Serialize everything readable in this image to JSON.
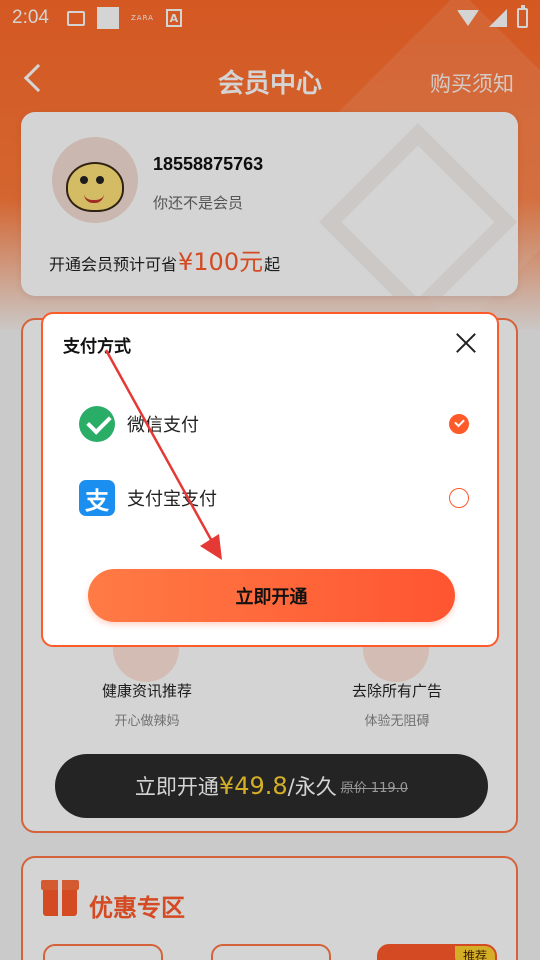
{
  "status_bar": {
    "time": "2:04",
    "notif_text_icon": "ZARA",
    "notif_letter_icon": "A"
  },
  "nav": {
    "title": "会员中心",
    "right_link": "购买须知"
  },
  "member_card": {
    "phone": "18558875763",
    "status": "你还不是会员",
    "save_prefix": "开通会员预计可省",
    "save_amount": "¥100元",
    "save_suffix": "起"
  },
  "benefits": [
    {
      "title": "健康资讯推荐",
      "subtitle": "开心做辣妈"
    },
    {
      "title": "去除所有广告",
      "subtitle": "体验无阻碍"
    }
  ],
  "open_bar": {
    "prefix": "立即开通",
    "price": "¥49.8",
    "period": "/永久",
    "original": "原价 119.0"
  },
  "promo": {
    "title": "优惠专区",
    "badge": "推荐"
  },
  "payment_dialog": {
    "title": "支付方式",
    "options": [
      {
        "label": "微信支付",
        "icon": "wechat-pay-icon",
        "selected": true
      },
      {
        "label": "支付宝支付",
        "icon": "alipay-icon",
        "selected": false
      }
    ],
    "alipay_glyph": "支",
    "confirm_label": "立即开通"
  },
  "colors": {
    "accent": "#ff5a2a",
    "price_yellow": "#ffd22e",
    "wechat_green": "#2aae67",
    "alipay_blue": "#1a8ff0",
    "annotation_red": "#e53935"
  }
}
